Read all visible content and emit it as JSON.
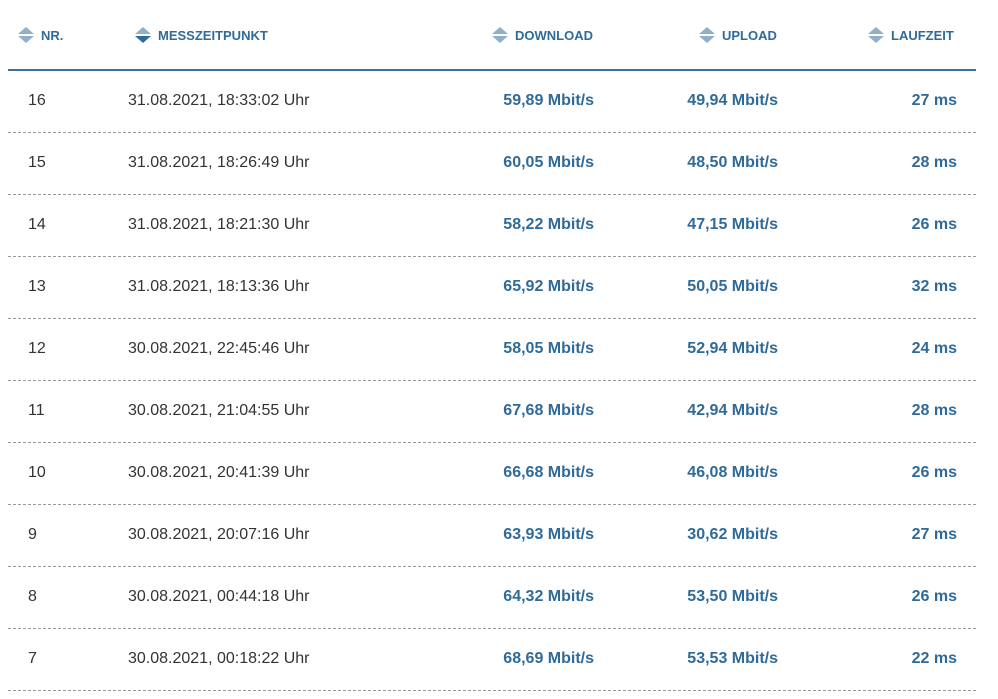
{
  "headers": {
    "nr": "NR.",
    "time": "MESSZEITPUNKT",
    "download": "DOWNLOAD",
    "upload": "UPLOAD",
    "latency": "LAUFZEIT"
  },
  "colors": {
    "accent": "#2f6a99"
  },
  "rows": [
    {
      "nr": "16",
      "time": "31.08.2021, 18:33:02 Uhr",
      "download": "59,89 Mbit/s",
      "upload": "49,94 Mbit/s",
      "latency": "27 ms"
    },
    {
      "nr": "15",
      "time": "31.08.2021, 18:26:49 Uhr",
      "download": "60,05 Mbit/s",
      "upload": "48,50 Mbit/s",
      "latency": "28 ms"
    },
    {
      "nr": "14",
      "time": "31.08.2021, 18:21:30 Uhr",
      "download": "58,22 Mbit/s",
      "upload": "47,15 Mbit/s",
      "latency": "26 ms"
    },
    {
      "nr": "13",
      "time": "31.08.2021, 18:13:36 Uhr",
      "download": "65,92 Mbit/s",
      "upload": "50,05 Mbit/s",
      "latency": "32 ms"
    },
    {
      "nr": "12",
      "time": "30.08.2021, 22:45:46 Uhr",
      "download": "58,05 Mbit/s",
      "upload": "52,94 Mbit/s",
      "latency": "24 ms"
    },
    {
      "nr": "11",
      "time": "30.08.2021, 21:04:55 Uhr",
      "download": "67,68 Mbit/s",
      "upload": "42,94 Mbit/s",
      "latency": "28 ms"
    },
    {
      "nr": "10",
      "time": "30.08.2021, 20:41:39 Uhr",
      "download": "66,68 Mbit/s",
      "upload": "46,08 Mbit/s",
      "latency": "26 ms"
    },
    {
      "nr": "9",
      "time": "30.08.2021, 20:07:16 Uhr",
      "download": "63,93 Mbit/s",
      "upload": "30,62 Mbit/s",
      "latency": "27 ms"
    },
    {
      "nr": "8",
      "time": "30.08.2021, 00:44:18 Uhr",
      "download": "64,32 Mbit/s",
      "upload": "53,50 Mbit/s",
      "latency": "26 ms"
    },
    {
      "nr": "7",
      "time": "30.08.2021, 00:18:22 Uhr",
      "download": "68,69 Mbit/s",
      "upload": "53,53 Mbit/s",
      "latency": "22 ms"
    }
  ]
}
